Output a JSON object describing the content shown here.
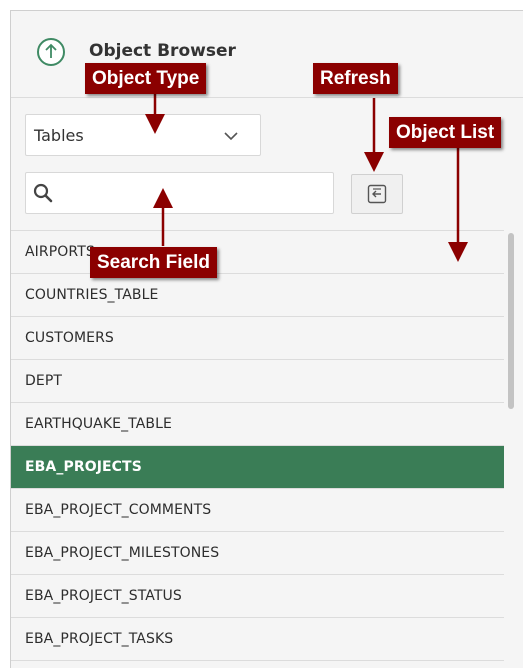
{
  "header": {
    "title": "Object Browser"
  },
  "object_type": {
    "selected": "Tables"
  },
  "search": {
    "value": "",
    "placeholder": ""
  },
  "list": {
    "items": [
      {
        "label": "AIRPORTS"
      },
      {
        "label": "COUNTRIES_TABLE"
      },
      {
        "label": "CUSTOMERS"
      },
      {
        "label": "DEPT"
      },
      {
        "label": "EARTHQUAKE_TABLE"
      },
      {
        "label": "EBA_PROJECTS",
        "selected": true
      },
      {
        "label": "EBA_PROJECT_COMMENTS"
      },
      {
        "label": "EBA_PROJECT_MILESTONES"
      },
      {
        "label": "EBA_PROJECT_STATUS"
      },
      {
        "label": "EBA_PROJECT_TASKS"
      }
    ]
  },
  "callouts": {
    "object_type": "Object Type",
    "refresh": "Refresh",
    "object_list": "Object List",
    "search_field": "Search Field"
  },
  "icons": {
    "up": "arrow-up-circle-icon",
    "chevron": "chevron-down-icon",
    "search": "search-icon",
    "refresh": "refresh-icon"
  },
  "colors": {
    "accent_green": "#3a7d56",
    "callout_red": "#8b0000"
  }
}
